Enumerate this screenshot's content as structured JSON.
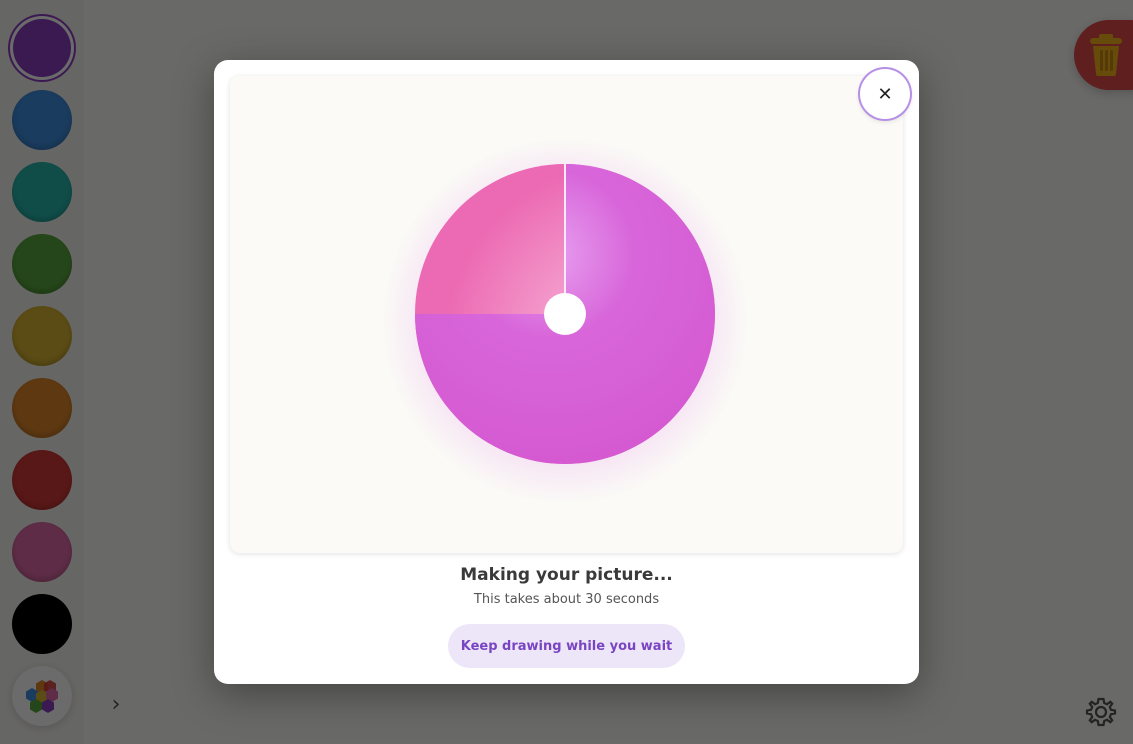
{
  "colors": {
    "swatches": [
      "#8e3fc4",
      "#3f8fe0",
      "#27b8ad",
      "#5aa83e",
      "#d9b534",
      "#e0872a",
      "#d53939",
      "#e06aa8",
      "#000000"
    ],
    "accent": "#8f5fd6",
    "progress_filled": "#d35fd8",
    "progress_remaining": "#ee66b8",
    "trash": "#e24a4a"
  },
  "sidebar": {
    "selected_index": 0,
    "swatch_names": [
      "purple",
      "blue",
      "teal",
      "green",
      "yellow",
      "orange",
      "red",
      "pink",
      "black"
    ],
    "palette_icon": "hexagon-palette-icon",
    "expand_icon": "chevron-right-icon",
    "expand_glyph": "›"
  },
  "toolbar": {
    "trash_icon": "trash-icon",
    "settings_icon": "gear-icon"
  },
  "modal": {
    "close_glyph": "✕",
    "close_icon": "close-icon",
    "progress_fraction": 0.75,
    "status_title": "Making your picture...",
    "status_subtitle": "This takes about 30 seconds",
    "keep_drawing_label": "Keep drawing while you wait"
  }
}
